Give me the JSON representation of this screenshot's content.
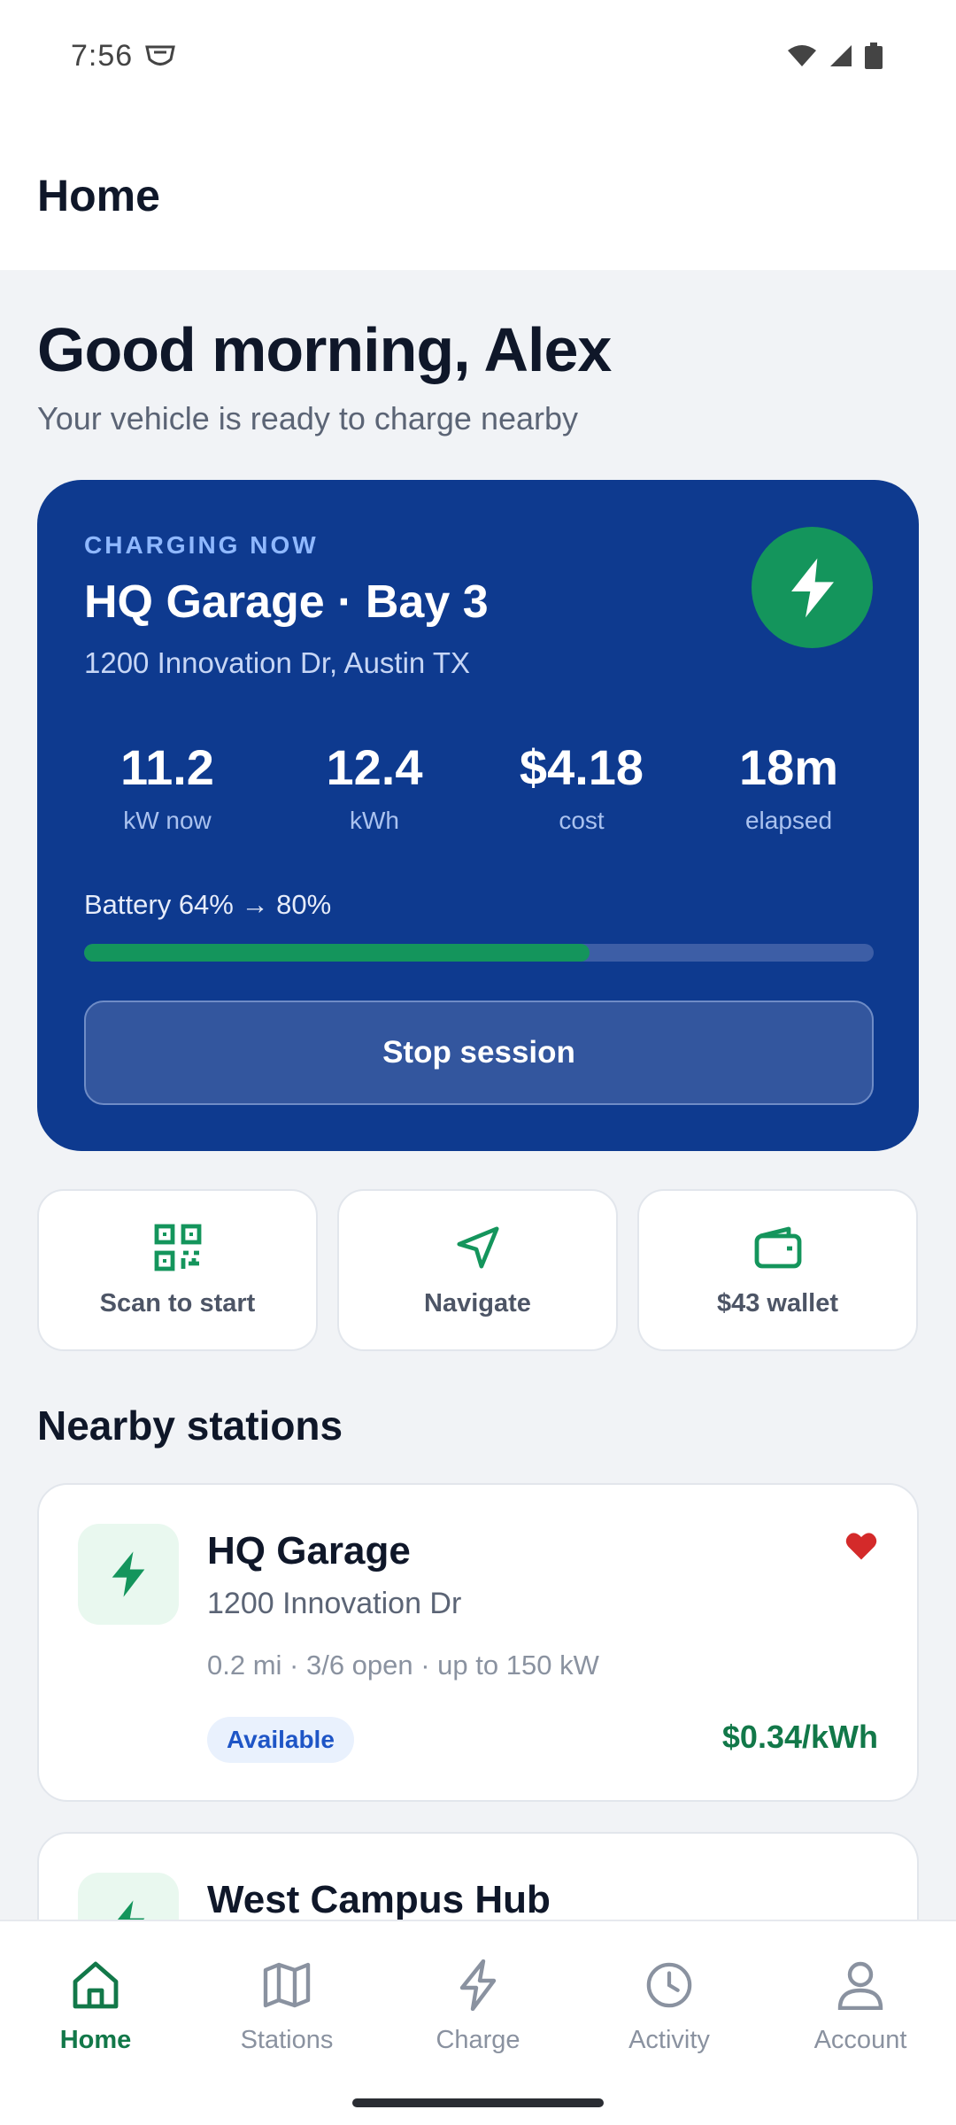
{
  "status_bar": {
    "time": "7:56"
  },
  "app_bar": {
    "title": "Home"
  },
  "greeting": {
    "title": "Good morning, Alex",
    "subtitle": "Your vehicle is ready to charge nearby"
  },
  "session": {
    "status_label": "CHARGING NOW",
    "station": "HQ Garage · Bay 3",
    "address": "1200 Innovation Dr, Austin TX",
    "stats": [
      {
        "value": "11.2",
        "label": "kW now"
      },
      {
        "value": "12.4",
        "label": "kWh"
      },
      {
        "value": "$4.18",
        "label": "cost"
      },
      {
        "value": "18m",
        "label": "elapsed"
      }
    ],
    "battery_label": "Battery 64% → 80%",
    "battery_progress_percent": 64,
    "stop_label": "Stop session",
    "accent_color": "#14955c"
  },
  "actions": [
    {
      "label": "Scan to start",
      "icon": "qr-code-icon"
    },
    {
      "label": "Navigate",
      "icon": "navigation-arrow-icon"
    },
    {
      "label": "$43 wallet",
      "icon": "wallet-icon"
    }
  ],
  "nearby": {
    "title": "Nearby stations",
    "stations": [
      {
        "name": "HQ Garage",
        "address": "1200 Innovation Dr",
        "meta": "0.2 mi · 3/6 open · up to 150 kW",
        "badge": "Available",
        "price": "$0.34/kWh",
        "favorite": true
      },
      {
        "name": "West Campus Hub"
      }
    ]
  },
  "bottom_nav": {
    "items": [
      {
        "label": "Home",
        "icon": "home-icon",
        "active": true
      },
      {
        "label": "Stations",
        "icon": "map-icon",
        "active": false
      },
      {
        "label": "Charge",
        "icon": "bolt-icon",
        "active": false
      },
      {
        "label": "Activity",
        "icon": "clock-icon",
        "active": false
      },
      {
        "label": "Account",
        "icon": "person-icon",
        "active": false
      }
    ]
  }
}
